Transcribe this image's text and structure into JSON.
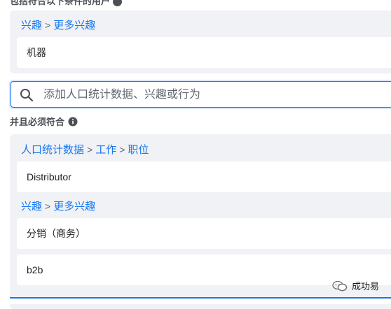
{
  "top_label_cut": "包括符合以下条件的用户",
  "include_panel": {
    "crumb": {
      "part1": "兴趣",
      "sep": ">",
      "part2": "更多兴趣"
    },
    "items": [
      "机器"
    ]
  },
  "search": {
    "placeholder": "添加人口统计数据、兴趣或行为"
  },
  "narrow": {
    "label": "并且必须符合",
    "crumb_a": {
      "part1": "人口统计数据",
      "sep1": ">",
      "part2": "工作",
      "sep2": ">",
      "part3": "职位"
    },
    "items_a": [
      "Distributor"
    ],
    "crumb_b": {
      "part1": "兴趣",
      "sep": ">",
      "part2": "更多兴趣"
    },
    "items_b": [
      "分销（商务）",
      "b2b"
    ]
  },
  "watermark": {
    "text": "成功易"
  },
  "colors": {
    "accent": "#1877f2",
    "panel": "#f0f2f5"
  }
}
